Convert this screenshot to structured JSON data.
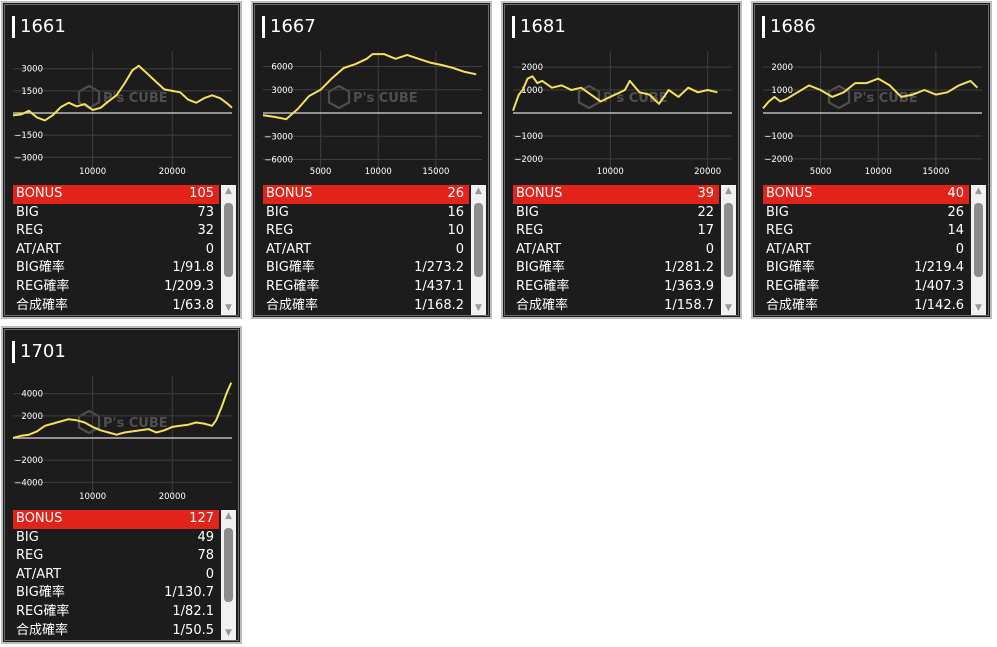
{
  "machines": [
    {
      "number": "1661",
      "rows": [
        {
          "label": "BONUS",
          "value": "105",
          "highlight": true
        },
        {
          "label": "BIG",
          "value": "73"
        },
        {
          "label": "REG",
          "value": "32"
        },
        {
          "label": "AT/ART",
          "value": "0"
        },
        {
          "label": "BIG確率",
          "value": "1/91.8"
        },
        {
          "label": "REG確率",
          "value": "1/209.3"
        },
        {
          "label": "合成確率",
          "value": "1/63.8"
        }
      ]
    },
    {
      "number": "1667",
      "rows": [
        {
          "label": "BONUS",
          "value": "26",
          "highlight": true
        },
        {
          "label": "BIG",
          "value": "16"
        },
        {
          "label": "REG",
          "value": "10"
        },
        {
          "label": "AT/ART",
          "value": "0"
        },
        {
          "label": "BIG確率",
          "value": "1/273.2"
        },
        {
          "label": "REG確率",
          "value": "1/437.1"
        },
        {
          "label": "合成確率",
          "value": "1/168.2"
        }
      ]
    },
    {
      "number": "1681",
      "rows": [
        {
          "label": "BONUS",
          "value": "39",
          "highlight": true
        },
        {
          "label": "BIG",
          "value": "22"
        },
        {
          "label": "REG",
          "value": "17"
        },
        {
          "label": "AT/ART",
          "value": "0"
        },
        {
          "label": "BIG確率",
          "value": "1/281.2"
        },
        {
          "label": "REG確率",
          "value": "1/363.9"
        },
        {
          "label": "合成確率",
          "value": "1/158.7"
        }
      ]
    },
    {
      "number": "1686",
      "rows": [
        {
          "label": "BONUS",
          "value": "40",
          "highlight": true
        },
        {
          "label": "BIG",
          "value": "26"
        },
        {
          "label": "REG",
          "value": "14"
        },
        {
          "label": "AT/ART",
          "value": "0"
        },
        {
          "label": "BIG確率",
          "value": "1/219.4"
        },
        {
          "label": "REG確率",
          "value": "1/407.3"
        },
        {
          "label": "合成確率",
          "value": "1/142.6"
        }
      ]
    },
    {
      "number": "1701",
      "rows": [
        {
          "label": "BONUS",
          "value": "127",
          "highlight": true
        },
        {
          "label": "BIG",
          "value": "49"
        },
        {
          "label": "REG",
          "value": "78"
        },
        {
          "label": "AT/ART",
          "value": "0"
        },
        {
          "label": "BIG確率",
          "value": "1/130.7"
        },
        {
          "label": "REG確率",
          "value": "1/82.1"
        },
        {
          "label": "合成確率",
          "value": "1/50.5"
        }
      ]
    }
  ],
  "watermark": "P's CUBE",
  "colors": {
    "line": "#f5e05a",
    "highlight": "#e2231a",
    "card_bg": "#1c1c1c"
  },
  "chart_data": [
    {
      "type": "line",
      "xlim": [
        0,
        27500
      ],
      "ylim": [
        -4200,
        4200
      ],
      "x_ticks": [
        10000,
        20000
      ],
      "y_ticks": [
        -3000,
        -1500,
        1500,
        3000
      ],
      "grid": true,
      "x": [
        0,
        1000,
        2000,
        3000,
        4000,
        5000,
        6000,
        7000,
        8000,
        9000,
        10000,
        11000,
        12000,
        13000,
        14000,
        15000,
        15800,
        17000,
        18000,
        19000,
        20000,
        21000,
        22000,
        23000,
        24000,
        25000,
        26000,
        27000,
        27500
      ],
      "y": [
        -150,
        -100,
        150,
        -300,
        -500,
        -150,
        400,
        700,
        450,
        600,
        200,
        350,
        800,
        1200,
        2000,
        2900,
        3200,
        2600,
        2100,
        1600,
        1500,
        1400,
        900,
        700,
        1000,
        1200,
        1000,
        600,
        350
      ]
    },
    {
      "type": "line",
      "xlim": [
        0,
        19000
      ],
      "ylim": [
        -8000,
        8000
      ],
      "x_ticks": [
        5000,
        10000,
        15000
      ],
      "y_ticks": [
        -6000,
        -3000,
        3000,
        6000
      ],
      "grid": true,
      "x": [
        0,
        1000,
        2000,
        3000,
        4000,
        5000,
        6000,
        7000,
        8000,
        9000,
        9500,
        10500,
        11500,
        12500,
        13500,
        14500,
        15500,
        16500,
        17500,
        18500
      ],
      "y": [
        -300,
        -500,
        -800,
        500,
        2200,
        3000,
        4500,
        5800,
        6300,
        7000,
        7600,
        7600,
        7000,
        7500,
        7000,
        6500,
        6200,
        5800,
        5300,
        5000
      ]
    },
    {
      "type": "line",
      "xlim": [
        0,
        22500
      ],
      "ylim": [
        -2700,
        2700
      ],
      "x_ticks": [
        10000,
        20000
      ],
      "y_ticks": [
        -2000,
        -1000,
        1000,
        2000
      ],
      "grid": true,
      "x": [
        0,
        600,
        1000,
        1500,
        2000,
        2500,
        3000,
        4000,
        5000,
        6000,
        7000,
        8000,
        9000,
        10000,
        11000,
        11500,
        12000,
        13000,
        14000,
        15000,
        16000,
        17000,
        18000,
        19000,
        20000,
        21000
      ],
      "y": [
        100,
        800,
        1000,
        1500,
        1600,
        1300,
        1400,
        1100,
        1200,
        1000,
        1100,
        800,
        500,
        700,
        900,
        1000,
        1400,
        900,
        800,
        400,
        1000,
        700,
        1100,
        900,
        1000,
        900
      ]
    },
    {
      "type": "line",
      "xlim": [
        0,
        19000
      ],
      "ylim": [
        -2700,
        2700
      ],
      "x_ticks": [
        5000,
        10000,
        15000
      ],
      "y_ticks": [
        -2000,
        -1000,
        1000,
        2000
      ],
      "grid": true,
      "x": [
        0,
        500,
        1000,
        1500,
        2000,
        3000,
        4000,
        5000,
        6000,
        7000,
        8000,
        9000,
        10000,
        11000,
        12000,
        13000,
        14000,
        15000,
        16000,
        17000,
        18000,
        18600
      ],
      "y": [
        200,
        500,
        700,
        500,
        600,
        900,
        1200,
        1000,
        700,
        900,
        1300,
        1300,
        1500,
        1200,
        700,
        800,
        1000,
        800,
        900,
        1200,
        1400,
        1100
      ]
    },
    {
      "type": "line",
      "xlim": [
        0,
        27500
      ],
      "ylim": [
        -5600,
        5600
      ],
      "x_ticks": [
        10000,
        20000
      ],
      "y_ticks": [
        -4000,
        -2000,
        2000,
        4000
      ],
      "grid": true,
      "x": [
        0,
        1000,
        2000,
        3000,
        4000,
        5000,
        6000,
        7000,
        8000,
        9000,
        10000,
        11000,
        12000,
        13000,
        14000,
        15000,
        16000,
        17000,
        18000,
        19000,
        20000,
        21000,
        22000,
        23000,
        24000,
        25000,
        25500,
        26200,
        26800,
        27400
      ],
      "y": [
        0,
        200,
        300,
        600,
        1100,
        1300,
        1500,
        1700,
        1600,
        1400,
        1000,
        700,
        500,
        300,
        500,
        600,
        700,
        800,
        500,
        700,
        1000,
        1100,
        1200,
        1400,
        1300,
        1100,
        1600,
        2800,
        4000,
        5000
      ]
    }
  ]
}
